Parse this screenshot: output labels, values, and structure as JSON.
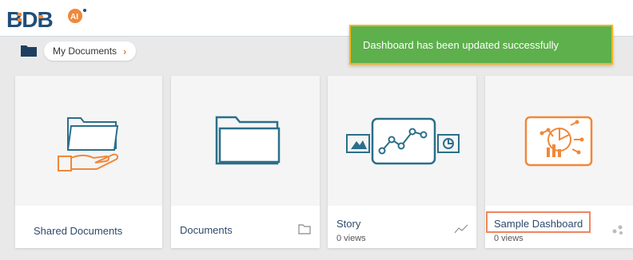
{
  "header": {
    "logo_text": "BDB",
    "logo_badge": "AI"
  },
  "breadcrumb": {
    "label": "My Documents"
  },
  "toast": {
    "message": "Dashboard has been updated successfully",
    "background": "#5db04b",
    "border": "#f5b41a"
  },
  "cards": [
    {
      "title": "Shared Documents",
      "icon": "shared-folder-hand-icon",
      "type_icon": ""
    },
    {
      "title": "Documents",
      "icon": "folder-icon",
      "type_icon": "folder-outline-icon"
    },
    {
      "title": "Story",
      "views": "0 views",
      "icon": "story-illustration-icon",
      "type_icon": "line-chart-icon"
    },
    {
      "title": "Sample Dashboard",
      "views": "0 views",
      "icon": "dashboard-analytics-icon",
      "type_icon": "share-network-icon"
    }
  ],
  "colors": {
    "accent_orange": "#f0883a",
    "folder_teal": "#2b6f8a",
    "highlight_border": "#f0855f"
  }
}
